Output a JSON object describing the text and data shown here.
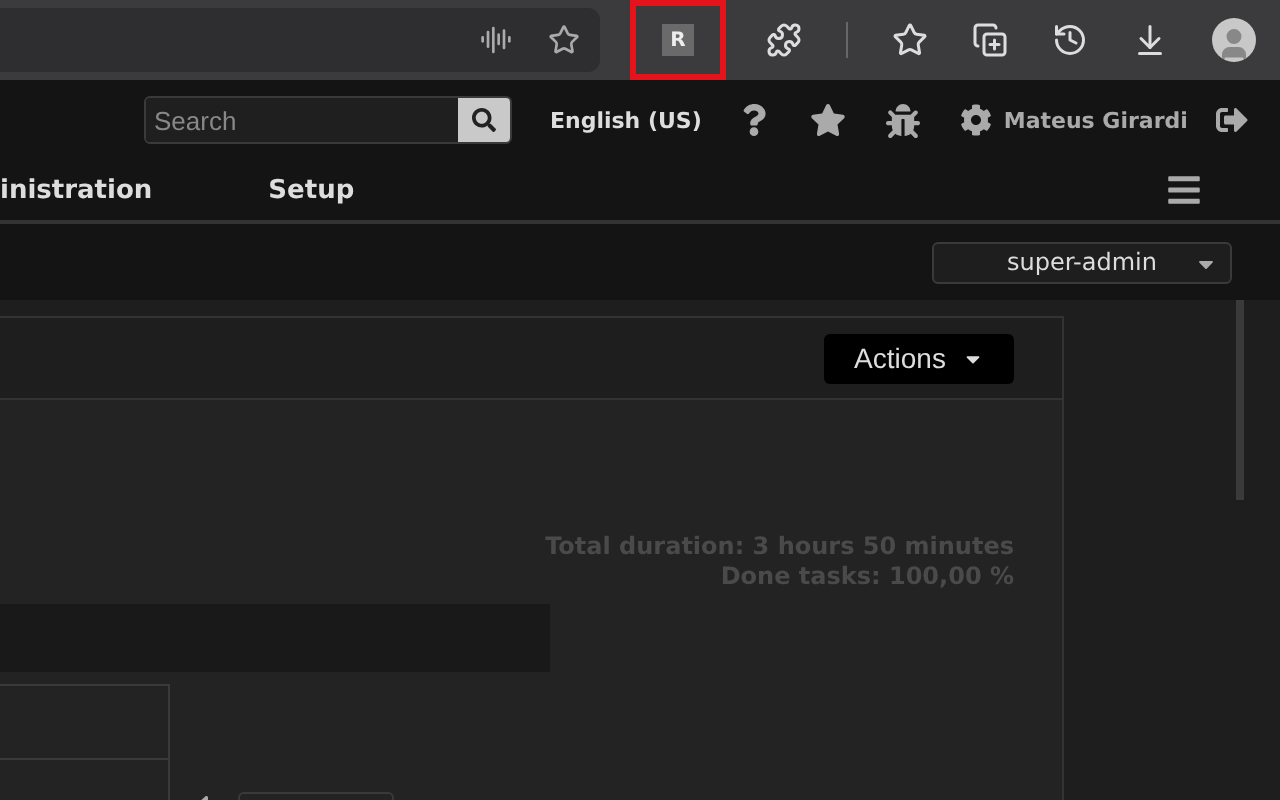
{
  "browser_toolbar": {
    "extension_badge": {
      "label": "R",
      "highlighted": true
    }
  },
  "header": {
    "search": {
      "placeholder": "Search"
    },
    "language": "English (US)",
    "user_name": "Mateus Girardi"
  },
  "nav": {
    "items": [
      {
        "label": "inistration",
        "selected": false
      },
      {
        "label": "Setup",
        "selected": false
      }
    ]
  },
  "role_select": {
    "value": "super-admin"
  },
  "panel": {
    "actions_button": "Actions",
    "summary": [
      "Total duration: 3 hours 50 minutes",
      "Done tasks: 100,00 %"
    ]
  }
}
